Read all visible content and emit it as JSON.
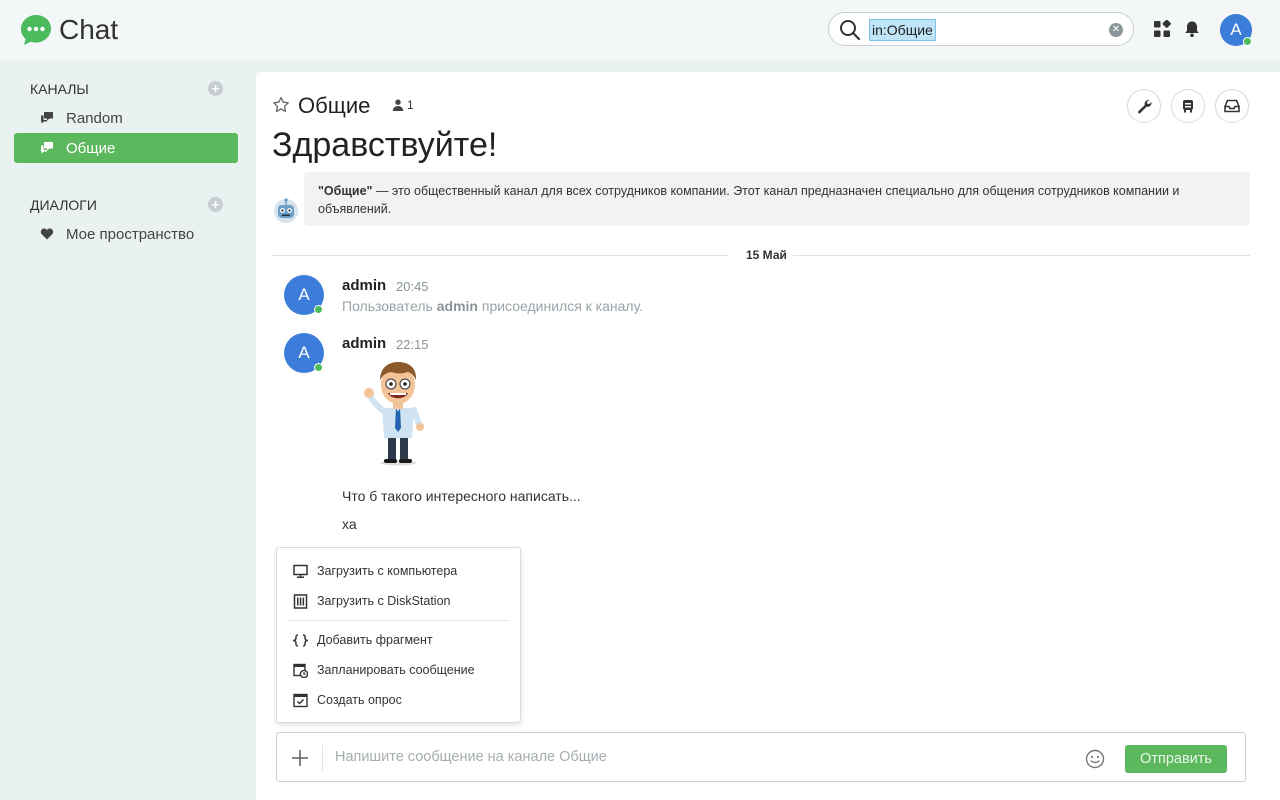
{
  "app": {
    "title": "Chat"
  },
  "search": {
    "value": "in:Общие"
  },
  "user": {
    "avatar_initial": "A"
  },
  "sidebar": {
    "channels_title": "КАНАЛЫ",
    "channels": [
      {
        "label": "Random",
        "active": false
      },
      {
        "label": "Общие",
        "active": true
      }
    ],
    "dialogs_title": "ДИАЛОГИ",
    "dialogs": [
      {
        "label": "Мое пространство"
      }
    ]
  },
  "channel": {
    "name": "Общие",
    "members_count": "1",
    "welcome": "Здравствуйте!",
    "description_name": "\"Общие\"",
    "description_text": " — это общественный канал для всех сотрудников компании. Этот канал предназначен специально для общения сотрудников компании и объявлений."
  },
  "messages": {
    "date": "15 Май",
    "items": [
      {
        "initial": "A",
        "author": "admin",
        "time": "20:45",
        "system_pre": "Пользователь ",
        "system_user": "admin",
        "system_post": " присоединился к каналу."
      },
      {
        "initial": "A",
        "author": "admin",
        "time": "22:15",
        "text1": "Что б такого интересного написать...",
        "text2": "ха"
      }
    ]
  },
  "attach_menu": {
    "items": [
      {
        "label": "Загрузить с компьютера",
        "icon": "monitor-icon"
      },
      {
        "label": "Загрузить с DiskStation",
        "icon": "nas-icon"
      },
      {
        "label": "Добавить фрагмент",
        "icon": "code-braces-icon"
      },
      {
        "label": "Запланировать сообщение",
        "icon": "schedule-icon"
      },
      {
        "label": "Создать опрос",
        "icon": "poll-icon"
      }
    ]
  },
  "composer": {
    "placeholder": "Напишите сообщение на канале Общие",
    "send_label": "Отправить"
  },
  "colors": {
    "accent": "#5cb85c",
    "avatar": "#3b7dd8",
    "online": "#4cbb5d"
  }
}
